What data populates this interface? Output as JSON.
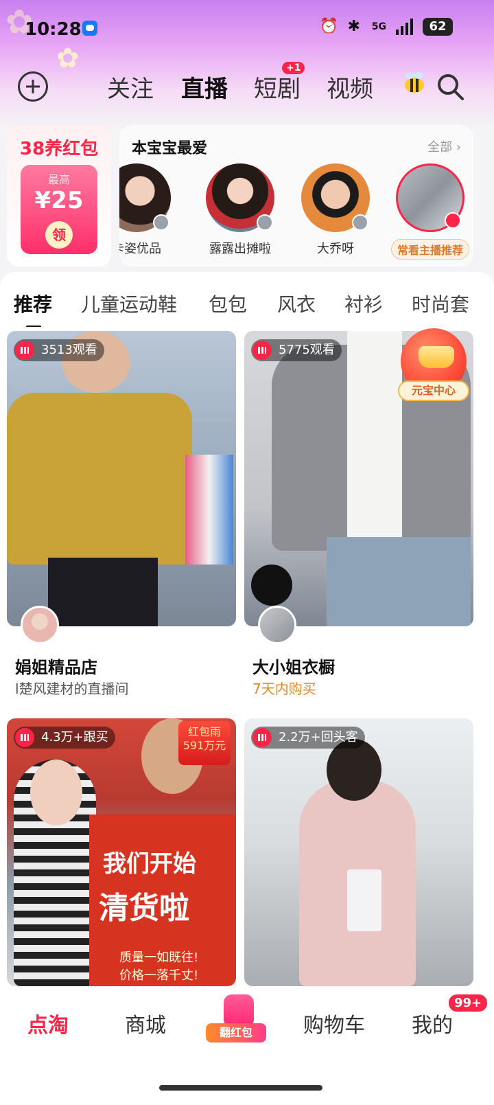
{
  "status_bar": {
    "time": "10:28",
    "network": "5G",
    "battery": "62"
  },
  "top_nav": {
    "tabs": [
      "关注",
      "直播",
      "短剧",
      "视频"
    ],
    "active_tab": "直播",
    "short_drama_badge": "+1"
  },
  "promo": {
    "title": "38养红包",
    "max_label": "最高",
    "amount": "¥25",
    "claim": "领"
  },
  "favorites": {
    "title": "本宝宝最爱",
    "all_label": "全部 ›",
    "items": [
      {
        "name": "卡姿优品"
      },
      {
        "name": "露露出摊啦"
      },
      {
        "name": "大乔呀"
      },
      {
        "name": "常看主播推荐"
      }
    ]
  },
  "category_tabs": [
    "推荐",
    "儿童运动鞋",
    "包包",
    "风衣",
    "衬衫",
    "时尚套"
  ],
  "active_category": "推荐",
  "cards": [
    {
      "viewers": "3513观看",
      "title": "娟姐精品店",
      "subtitle": "l楚风建材的直播间"
    },
    {
      "viewers": "5775观看",
      "title": "大小姐衣橱",
      "subtitle": "7天内购买"
    },
    {
      "viewers": "4.3万+跟买",
      "red_packet_label": "红包雨",
      "red_packet_amount": "591万元",
      "banner_line1": "我们开始",
      "banner_line2": "清货啦",
      "banner_line3": "质量一如既往!",
      "banner_line4": "价格一落千丈!"
    },
    {
      "viewers": "2.2万+回头客"
    }
  ],
  "yuanbao_label": "元宝中心",
  "bottom_tabs": {
    "home": "点淘",
    "mall": "商城",
    "center": "翻红包",
    "cart": "购物车",
    "me": "我的",
    "me_badge": "99+"
  },
  "colors": {
    "accent": "#ff2448",
    "header_top": "#c87ff0",
    "orange_text": "#d88a2c"
  }
}
